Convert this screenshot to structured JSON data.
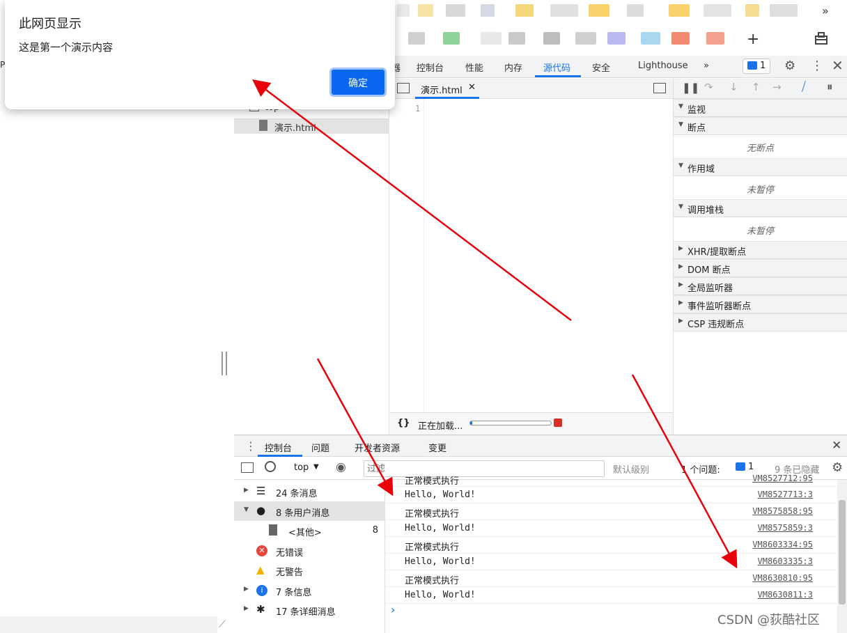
{
  "dialog": {
    "title": "此网页显示",
    "message": "这是第一个演示内容",
    "ok_label": "确定"
  },
  "page": {
    "left_edge_text": "P"
  },
  "topbar": {
    "more_label": "»",
    "plus_label": "+"
  },
  "devtools": {
    "tabs": [
      {
        "label": "器",
        "active": false
      },
      {
        "label": "控制台",
        "active": false
      },
      {
        "label": "性能",
        "active": false
      },
      {
        "label": "内存",
        "active": false
      },
      {
        "label": "源代码",
        "active": true
      },
      {
        "label": "安全",
        "active": false
      },
      {
        "label": "Lighthouse",
        "active": false
      }
    ],
    "more_tabs": "»",
    "issues_count": "1"
  },
  "navigator": {
    "top_label": "top",
    "file_label": "演示.html"
  },
  "editor": {
    "tab_label": "演示.html",
    "line_number": "1",
    "status_braces": "{}",
    "status_text": "正在加载..."
  },
  "debugger": {
    "sections": [
      {
        "label": "监视",
        "expanded": true
      },
      {
        "label": "断点",
        "expanded": true,
        "empty": "无断点"
      },
      {
        "label": "作用域",
        "expanded": true,
        "empty": "未暂停"
      },
      {
        "label": "调用堆栈",
        "expanded": true,
        "empty": "未暂停"
      },
      {
        "label": "XHR/提取断点",
        "expanded": false
      },
      {
        "label": "DOM 断点",
        "expanded": false
      },
      {
        "label": "全局监听器",
        "expanded": false
      },
      {
        "label": "事件监听器断点",
        "expanded": false
      },
      {
        "label": "CSP 违规断点",
        "expanded": false
      }
    ]
  },
  "drawer": {
    "tabs": [
      "控制台",
      "问题",
      "开发者资源",
      "变更"
    ],
    "active_tab": "控制台"
  },
  "console_toolbar": {
    "context": "top",
    "filter_placeholder": "过滤",
    "level": "默认级别",
    "issues_label": "1 个问题:",
    "issues_count": "1",
    "hidden": "9 条已隐藏"
  },
  "console_sidebar": [
    {
      "label": "24 条消息",
      "icon": "list-icon",
      "count": ""
    },
    {
      "label": "8 条用户消息",
      "icon": "user-icon",
      "count": ""
    },
    {
      "label": "<其他>",
      "icon": "file-icon",
      "count": "8"
    },
    {
      "label": "无错误",
      "icon": "error-icon",
      "count": ""
    },
    {
      "label": "无警告",
      "icon": "warning-icon",
      "count": ""
    },
    {
      "label": "7 条信息",
      "icon": "info-icon",
      "count": ""
    },
    {
      "label": "17 条详细消息",
      "icon": "bug-icon",
      "count": ""
    }
  ],
  "console_messages": [
    {
      "text": "正常模式执行",
      "source": "VM8527712:95"
    },
    {
      "text": "Hello, World!",
      "source": "VM8527713:3"
    },
    {
      "text": "正常模式执行",
      "source": "VM8575858:95"
    },
    {
      "text": "Hello, World!",
      "source": "VM8575859:3"
    },
    {
      "text": "正常模式执行",
      "source": "VM8603334:95"
    },
    {
      "text": "Hello, World!",
      "source": "VM8603335:3"
    },
    {
      "text": "正常模式执行",
      "source": "VM8630810:95"
    },
    {
      "text": "Hello, World!",
      "source": "VM8630811:3"
    }
  ],
  "console_prompt": "›",
  "watermark": "CSDN @荻酷社区",
  "colors": {
    "accent": "#1a73e8",
    "arrow": "#e8000b",
    "ok_button": "#0b67f0"
  }
}
